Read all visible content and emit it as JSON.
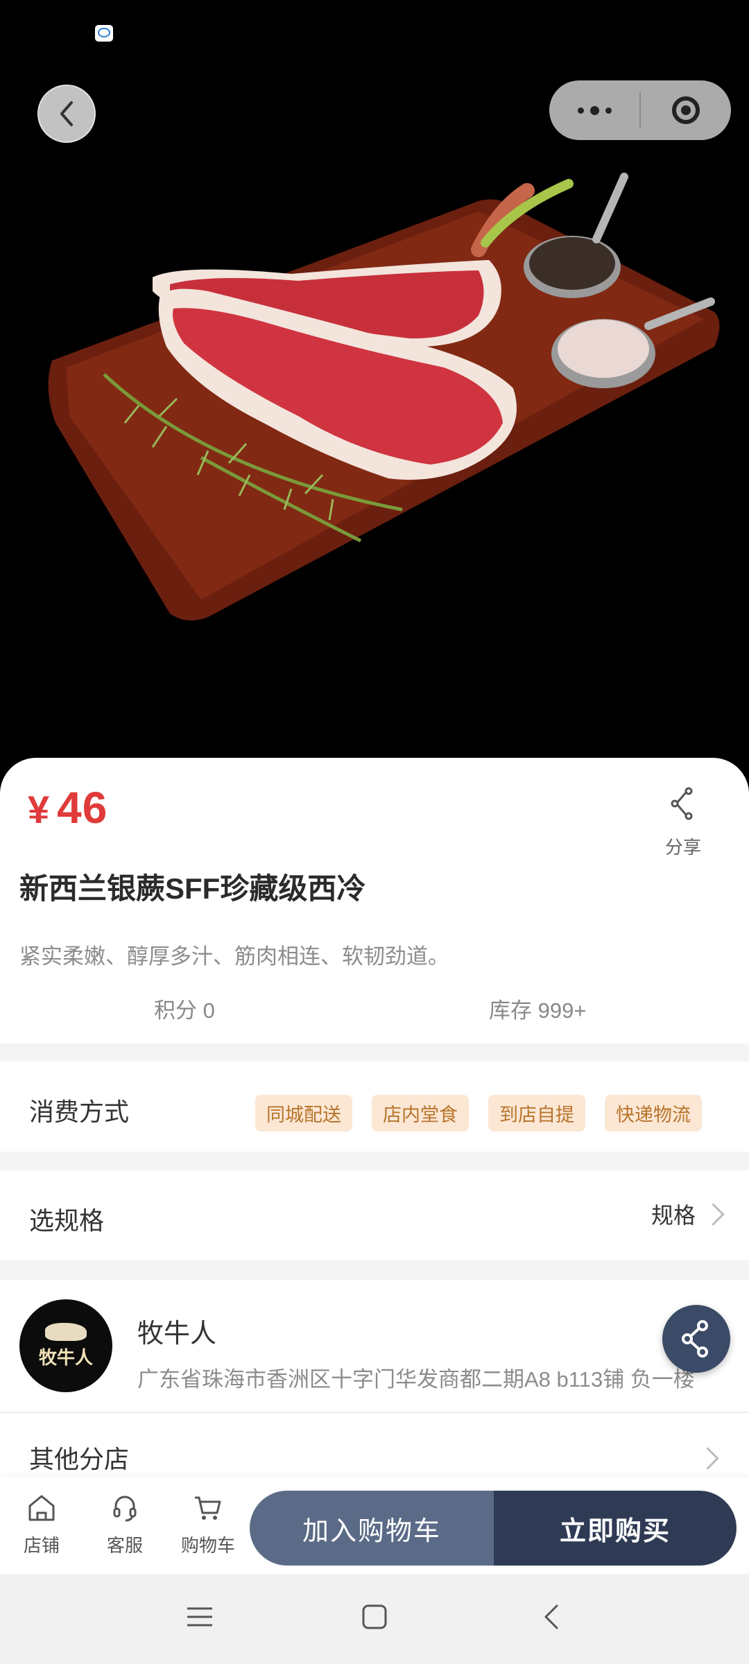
{
  "product": {
    "currency": "¥",
    "price": "46",
    "title": "新西兰银蕨SFF珍藏级西冷",
    "description": "紧实柔嫩、醇厚多汁、筋肉相连、软韧劲道。",
    "points": "积分 0",
    "stock": "库存 999+",
    "image_icon": "steak-on-board-image"
  },
  "share": {
    "label": "分享"
  },
  "consume": {
    "label": "消费方式",
    "tags": [
      "同城配送",
      "店内堂食",
      "到店自提",
      "快递物流"
    ]
  },
  "spec": {
    "label": "选规格",
    "value": "规格"
  },
  "store": {
    "name": "牧牛人",
    "address": "广东省珠海市香洲区十字门华发商都二期A8 b113铺 负一楼",
    "logo_text": "牧牛人",
    "branches_label": "其他分店"
  },
  "bottom_nav": {
    "items": [
      {
        "label": "店铺",
        "icon": "store-icon"
      },
      {
        "label": "客服",
        "icon": "headset-icon"
      },
      {
        "label": "购物车",
        "icon": "cart-icon"
      }
    ],
    "add_to_cart": "加入购物车",
    "buy_now": "立即购买"
  },
  "colors": {
    "price": "#e03a3a",
    "tag_bg": "#fbe7d4",
    "tag_text": "#b8742c",
    "cart_button": "#5b6b87",
    "buy_button": "#2f3b55"
  }
}
